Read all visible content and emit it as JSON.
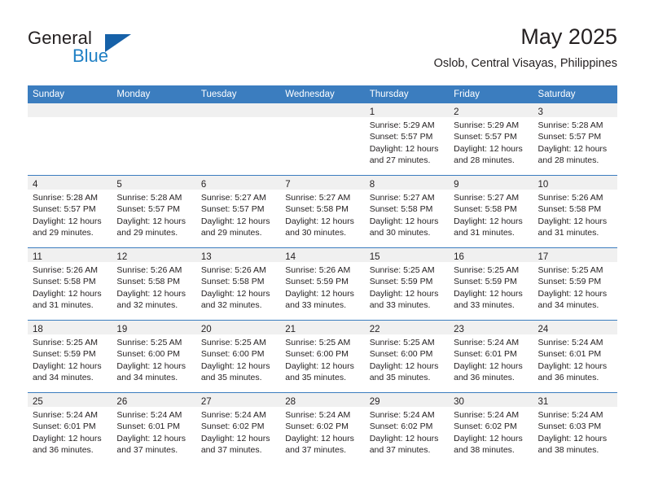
{
  "brand": {
    "word_general": "General",
    "word_blue": "Blue",
    "logo_icon": "triangle-icon"
  },
  "header": {
    "month_title": "May 2025",
    "location": "Oslob, Central Visayas, Philippines"
  },
  "calendar": {
    "weekday_headers": [
      "Sunday",
      "Monday",
      "Tuesday",
      "Wednesday",
      "Thursday",
      "Friday",
      "Saturday"
    ],
    "accent_color": "#3b7dbf",
    "daynum_band_color": "#f0f0f0",
    "weeks": [
      [
        {
          "empty": true
        },
        {
          "empty": true
        },
        {
          "empty": true
        },
        {
          "empty": true
        },
        {
          "day": "1",
          "sunrise": "Sunrise: 5:29 AM",
          "sunset": "Sunset: 5:57 PM",
          "daylight_1": "Daylight: 12 hours",
          "daylight_2": "and 27 minutes."
        },
        {
          "day": "2",
          "sunrise": "Sunrise: 5:29 AM",
          "sunset": "Sunset: 5:57 PM",
          "daylight_1": "Daylight: 12 hours",
          "daylight_2": "and 28 minutes."
        },
        {
          "day": "3",
          "sunrise": "Sunrise: 5:28 AM",
          "sunset": "Sunset: 5:57 PM",
          "daylight_1": "Daylight: 12 hours",
          "daylight_2": "and 28 minutes."
        }
      ],
      [
        {
          "day": "4",
          "sunrise": "Sunrise: 5:28 AM",
          "sunset": "Sunset: 5:57 PM",
          "daylight_1": "Daylight: 12 hours",
          "daylight_2": "and 29 minutes."
        },
        {
          "day": "5",
          "sunrise": "Sunrise: 5:28 AM",
          "sunset": "Sunset: 5:57 PM",
          "daylight_1": "Daylight: 12 hours",
          "daylight_2": "and 29 minutes."
        },
        {
          "day": "6",
          "sunrise": "Sunrise: 5:27 AM",
          "sunset": "Sunset: 5:57 PM",
          "daylight_1": "Daylight: 12 hours",
          "daylight_2": "and 29 minutes."
        },
        {
          "day": "7",
          "sunrise": "Sunrise: 5:27 AM",
          "sunset": "Sunset: 5:58 PM",
          "daylight_1": "Daylight: 12 hours",
          "daylight_2": "and 30 minutes."
        },
        {
          "day": "8",
          "sunrise": "Sunrise: 5:27 AM",
          "sunset": "Sunset: 5:58 PM",
          "daylight_1": "Daylight: 12 hours",
          "daylight_2": "and 30 minutes."
        },
        {
          "day": "9",
          "sunrise": "Sunrise: 5:27 AM",
          "sunset": "Sunset: 5:58 PM",
          "daylight_1": "Daylight: 12 hours",
          "daylight_2": "and 31 minutes."
        },
        {
          "day": "10",
          "sunrise": "Sunrise: 5:26 AM",
          "sunset": "Sunset: 5:58 PM",
          "daylight_1": "Daylight: 12 hours",
          "daylight_2": "and 31 minutes."
        }
      ],
      [
        {
          "day": "11",
          "sunrise": "Sunrise: 5:26 AM",
          "sunset": "Sunset: 5:58 PM",
          "daylight_1": "Daylight: 12 hours",
          "daylight_2": "and 31 minutes."
        },
        {
          "day": "12",
          "sunrise": "Sunrise: 5:26 AM",
          "sunset": "Sunset: 5:58 PM",
          "daylight_1": "Daylight: 12 hours",
          "daylight_2": "and 32 minutes."
        },
        {
          "day": "13",
          "sunrise": "Sunrise: 5:26 AM",
          "sunset": "Sunset: 5:58 PM",
          "daylight_1": "Daylight: 12 hours",
          "daylight_2": "and 32 minutes."
        },
        {
          "day": "14",
          "sunrise": "Sunrise: 5:26 AM",
          "sunset": "Sunset: 5:59 PM",
          "daylight_1": "Daylight: 12 hours",
          "daylight_2": "and 33 minutes."
        },
        {
          "day": "15",
          "sunrise": "Sunrise: 5:25 AM",
          "sunset": "Sunset: 5:59 PM",
          "daylight_1": "Daylight: 12 hours",
          "daylight_2": "and 33 minutes."
        },
        {
          "day": "16",
          "sunrise": "Sunrise: 5:25 AM",
          "sunset": "Sunset: 5:59 PM",
          "daylight_1": "Daylight: 12 hours",
          "daylight_2": "and 33 minutes."
        },
        {
          "day": "17",
          "sunrise": "Sunrise: 5:25 AM",
          "sunset": "Sunset: 5:59 PM",
          "daylight_1": "Daylight: 12 hours",
          "daylight_2": "and 34 minutes."
        }
      ],
      [
        {
          "day": "18",
          "sunrise": "Sunrise: 5:25 AM",
          "sunset": "Sunset: 5:59 PM",
          "daylight_1": "Daylight: 12 hours",
          "daylight_2": "and 34 minutes."
        },
        {
          "day": "19",
          "sunrise": "Sunrise: 5:25 AM",
          "sunset": "Sunset: 6:00 PM",
          "daylight_1": "Daylight: 12 hours",
          "daylight_2": "and 34 minutes."
        },
        {
          "day": "20",
          "sunrise": "Sunrise: 5:25 AM",
          "sunset": "Sunset: 6:00 PM",
          "daylight_1": "Daylight: 12 hours",
          "daylight_2": "and 35 minutes."
        },
        {
          "day": "21",
          "sunrise": "Sunrise: 5:25 AM",
          "sunset": "Sunset: 6:00 PM",
          "daylight_1": "Daylight: 12 hours",
          "daylight_2": "and 35 minutes."
        },
        {
          "day": "22",
          "sunrise": "Sunrise: 5:25 AM",
          "sunset": "Sunset: 6:00 PM",
          "daylight_1": "Daylight: 12 hours",
          "daylight_2": "and 35 minutes."
        },
        {
          "day": "23",
          "sunrise": "Sunrise: 5:24 AM",
          "sunset": "Sunset: 6:01 PM",
          "daylight_1": "Daylight: 12 hours",
          "daylight_2": "and 36 minutes."
        },
        {
          "day": "24",
          "sunrise": "Sunrise: 5:24 AM",
          "sunset": "Sunset: 6:01 PM",
          "daylight_1": "Daylight: 12 hours",
          "daylight_2": "and 36 minutes."
        }
      ],
      [
        {
          "day": "25",
          "sunrise": "Sunrise: 5:24 AM",
          "sunset": "Sunset: 6:01 PM",
          "daylight_1": "Daylight: 12 hours",
          "daylight_2": "and 36 minutes."
        },
        {
          "day": "26",
          "sunrise": "Sunrise: 5:24 AM",
          "sunset": "Sunset: 6:01 PM",
          "daylight_1": "Daylight: 12 hours",
          "daylight_2": "and 37 minutes."
        },
        {
          "day": "27",
          "sunrise": "Sunrise: 5:24 AM",
          "sunset": "Sunset: 6:02 PM",
          "daylight_1": "Daylight: 12 hours",
          "daylight_2": "and 37 minutes."
        },
        {
          "day": "28",
          "sunrise": "Sunrise: 5:24 AM",
          "sunset": "Sunset: 6:02 PM",
          "daylight_1": "Daylight: 12 hours",
          "daylight_2": "and 37 minutes."
        },
        {
          "day": "29",
          "sunrise": "Sunrise: 5:24 AM",
          "sunset": "Sunset: 6:02 PM",
          "daylight_1": "Daylight: 12 hours",
          "daylight_2": "and 37 minutes."
        },
        {
          "day": "30",
          "sunrise": "Sunrise: 5:24 AM",
          "sunset": "Sunset: 6:02 PM",
          "daylight_1": "Daylight: 12 hours",
          "daylight_2": "and 38 minutes."
        },
        {
          "day": "31",
          "sunrise": "Sunrise: 5:24 AM",
          "sunset": "Sunset: 6:03 PM",
          "daylight_1": "Daylight: 12 hours",
          "daylight_2": "and 38 minutes."
        }
      ]
    ]
  }
}
